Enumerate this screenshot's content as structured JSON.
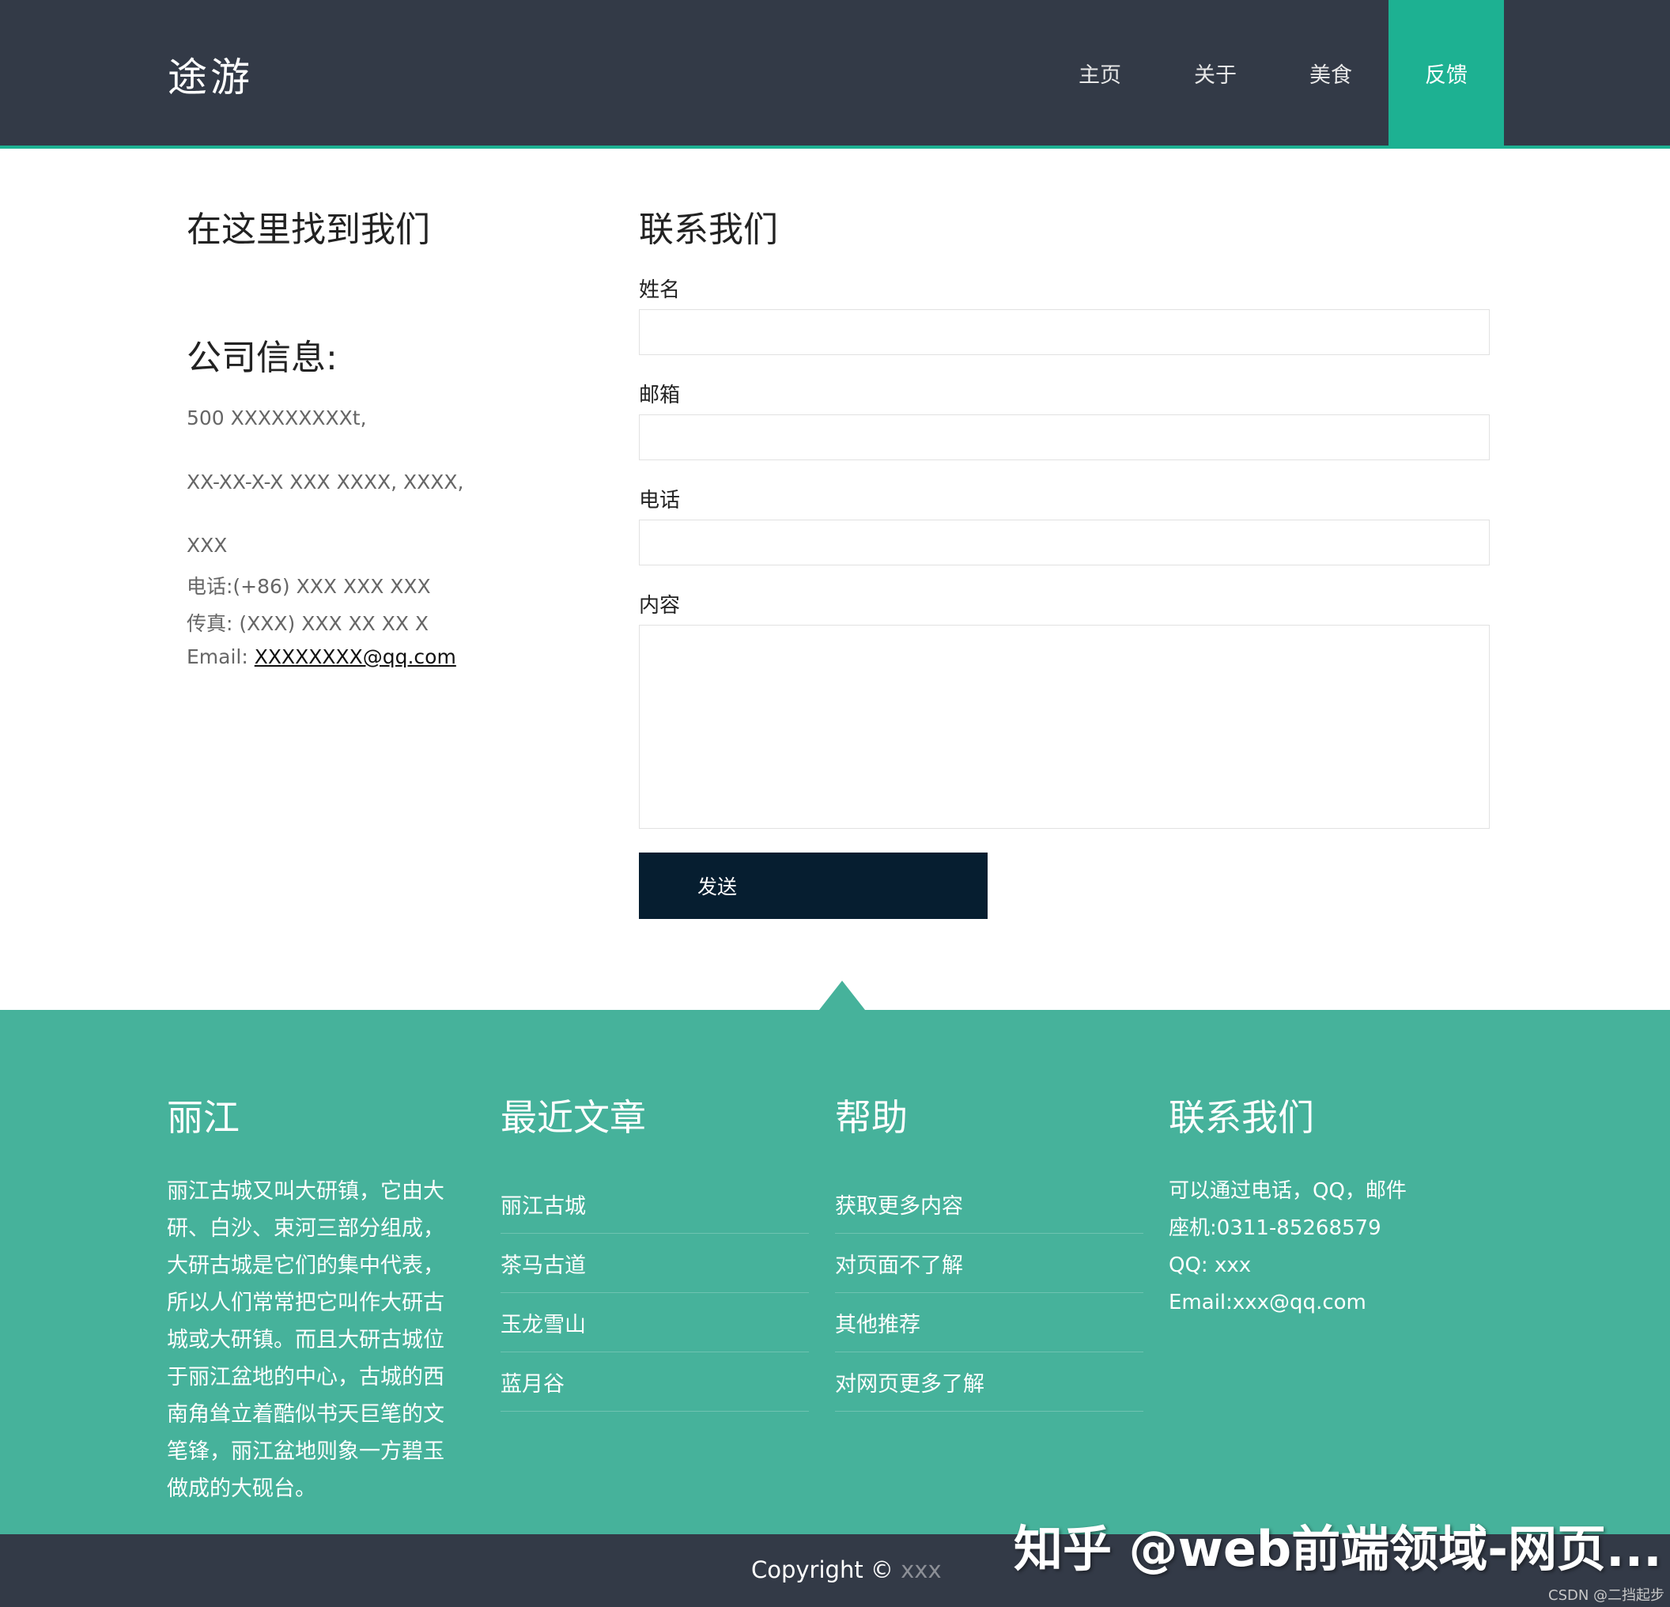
{
  "header": {
    "logo": "途游",
    "nav": [
      "主页",
      "关于",
      "美食",
      "反馈"
    ],
    "active_index": 3
  },
  "left": {
    "find_title": "在这里找到我们",
    "company_title": "公司信息:",
    "address1": "500 XXXXXXXXXt,",
    "address2": "XX-XX-X-X XXX XXXX, XXXX,",
    "address3": "XXX",
    "phone": "电话:(+86) XXX XXX XXX",
    "fax": "传真: (XXX) XXX XX XX X",
    "email_label": "Email: ",
    "email": "XXXXXXXX@qq.com"
  },
  "form": {
    "title": "联系我们",
    "name_label": "姓名",
    "email_label": "邮箱",
    "phone_label": "电话",
    "content_label": "内容",
    "send": "发送"
  },
  "footer": {
    "col1_title": "丽江",
    "col1_text": "丽江古城又叫大研镇，它由大研、白沙、束河三部分组成，大研古城是它们的集中代表，所以人们常常把它叫作大研古城或大研镇。而且大研古城位于丽江盆地的中心，古城的西南角耸立着酷似书天巨笔的文笔锋，丽江盆地则象一方碧玉做成的大砚台。",
    "col2_title": "最近文章",
    "col2_links": [
      "丽江古城",
      "茶马古道",
      "玉龙雪山",
      "蓝月谷"
    ],
    "col3_title": "帮助",
    "col3_links": [
      "获取更多内容",
      "对页面不了解",
      "其他推荐",
      "对网页更多了解"
    ],
    "col4_title": "联系我们",
    "col4_lines": [
      "可以通过电话，QQ，邮件",
      "座机:0311-85268579",
      "QQ: xxx",
      "Email:xxx@qq.com"
    ]
  },
  "bottom": {
    "copyright": "Copyright © ",
    "owner": "xxx"
  },
  "overlay": {
    "watermark": "知乎 @web前端领域-网页...",
    "csdn": "CSDN @二挡起步"
  },
  "colors": {
    "header_bg": "#333a47",
    "accent": "#1db192",
    "footer_bg": "#46b29b",
    "button_bg": "#061e30"
  }
}
